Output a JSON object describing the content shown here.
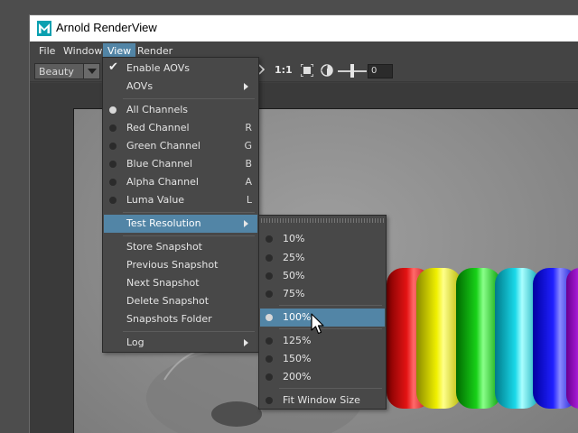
{
  "window": {
    "title": "Arnold RenderView"
  },
  "menubar": {
    "items": [
      "File",
      "Window",
      "View",
      "Render"
    ]
  },
  "toolbar": {
    "channel_combo": "Beauty",
    "ratio_label": "1:1",
    "slider_value": "0"
  },
  "view_menu": {
    "enable_aovs": "Enable AOVs",
    "aovs": "AOVs",
    "channels": [
      {
        "label": "All Channels",
        "shortcut": ""
      },
      {
        "label": "Red Channel",
        "shortcut": "R"
      },
      {
        "label": "Green Channel",
        "shortcut": "G"
      },
      {
        "label": "Blue Channel",
        "shortcut": "B"
      },
      {
        "label": "Alpha Channel",
        "shortcut": "A"
      },
      {
        "label": "Luma Value",
        "shortcut": "L"
      }
    ],
    "test_resolution": "Test Resolution",
    "snapshots": [
      "Store Snapshot",
      "Previous Snapshot",
      "Next Snapshot",
      "Delete Snapshot",
      "Snapshots Folder"
    ],
    "log": "Log"
  },
  "resolution_menu": {
    "options": [
      "10%",
      "25%",
      "50%",
      "75%",
      "100%",
      "125%",
      "150%",
      "200%"
    ],
    "fit": "Fit Window Size",
    "selected": "100%"
  },
  "colors": {
    "accent": "#5285a6",
    "menu_bg": "#484848"
  }
}
